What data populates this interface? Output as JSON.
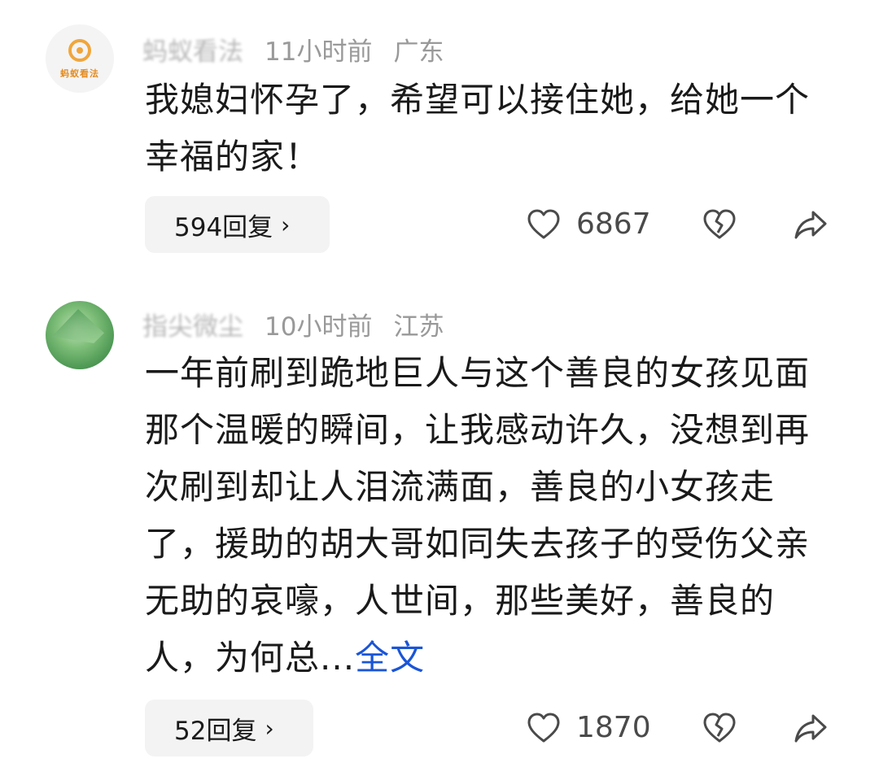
{
  "comments": [
    {
      "avatar_logo_text": "蚂蚁看法",
      "username": "蚂蚁看法",
      "time": "11小时前",
      "location": "广东",
      "text": "我媳妇怀孕了，希望可以接住她，给她一个幸福的家！",
      "more_link": "",
      "reply_label": "594回复",
      "like_count": "6867"
    },
    {
      "username": "指尖微尘",
      "time": "10小时前",
      "location": "江苏",
      "text": "一年前刷到跪地巨人与这个善良的女孩见面那个温暖的瞬间，让我感动许久，没想到再次刷到却让人泪流满面，善良的小女孩走了，援助的胡大哥如同失去孩子的受伤父亲无助的哀嚎，人世间，那些美好，善良的人，为何总...",
      "more_link": "全文",
      "reply_label": "52回复",
      "like_count": "1870"
    }
  ],
  "icons": {
    "like": "heart-outline-icon",
    "dislike": "broken-heart-icon",
    "share": "share-arrow-icon",
    "chevron": "chevron-right-icon"
  },
  "colors": {
    "text": "#1a1a1a",
    "meta": "#999999",
    "link": "#1a55d6",
    "reply_bg": "#f3f3f3"
  }
}
